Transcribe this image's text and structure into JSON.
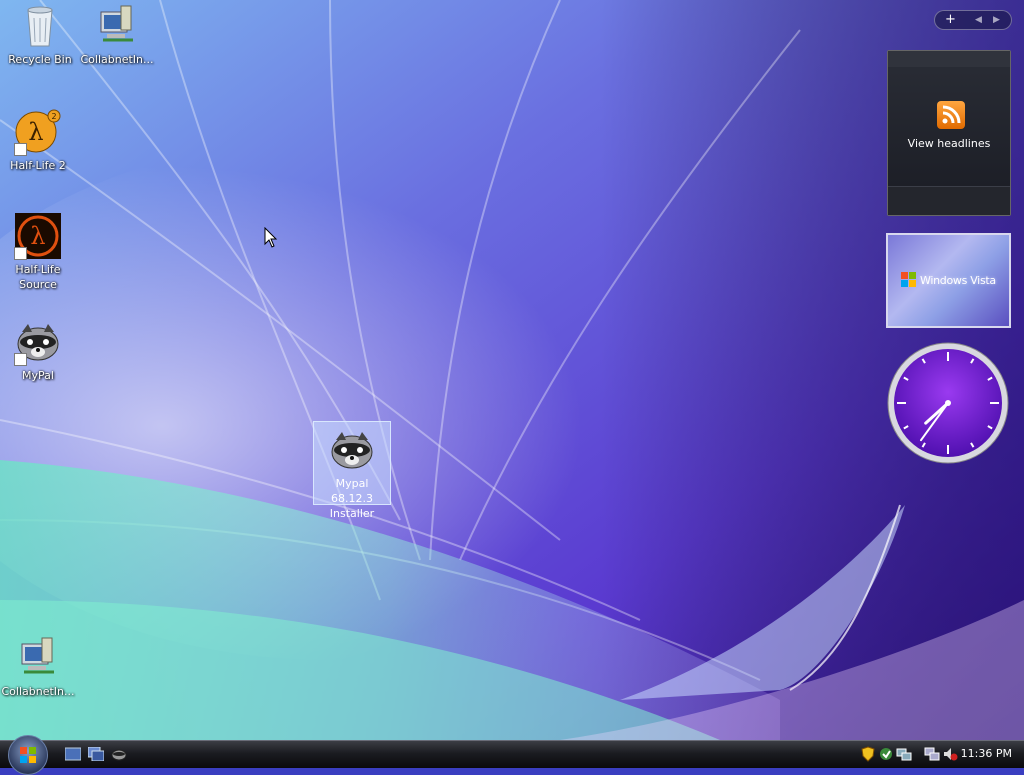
{
  "desktop": {
    "icons": [
      {
        "id": "recycle-bin",
        "label": "Recycle Bin",
        "icon": "recycle-bin-icon"
      },
      {
        "id": "collabnet-top",
        "label": "CollabnetIn...",
        "icon": "computer-network-icon"
      },
      {
        "id": "half-life-2",
        "label": "Half-Life 2",
        "icon": "half-life-2-icon"
      },
      {
        "id": "half-life-source",
        "label": "Half-Life Source",
        "icon": "half-life-source-icon"
      },
      {
        "id": "mypal",
        "label": "MyPal",
        "icon": "raccoon-icon"
      },
      {
        "id": "collabnet-bottom",
        "label": "CollabnetIn...",
        "icon": "computer-network-icon"
      },
      {
        "id": "mypal-installer",
        "label": "Mypal 68.12.3 Installer",
        "icon": "raccoon-icon",
        "selected": true
      }
    ]
  },
  "sidebar": {
    "controls": {
      "add": "+",
      "prev": "◀",
      "next": "▶"
    },
    "feed_gadget": {
      "label": "View headlines",
      "icon": "rss-icon"
    },
    "slideshow_gadget": {
      "caption": "Windows Vista",
      "icon": "windows-flag-icon"
    },
    "clock_gadget": {
      "hour": 7,
      "minute": 36
    }
  },
  "taskbar": {
    "start_icon": "windows-start-orb-icon",
    "quick_launch": [
      "show-desktop-icon",
      "switch-windows-icon",
      "mypal-quicklaunch-icon"
    ],
    "tray_icons": [
      "security-shield-icon",
      "windows-update-icon",
      "network-icon",
      "volume-muted-icon"
    ],
    "clock": "11:36 PM"
  },
  "colors": {
    "accent": "#6a2bd8",
    "taskbar": "#111216"
  }
}
